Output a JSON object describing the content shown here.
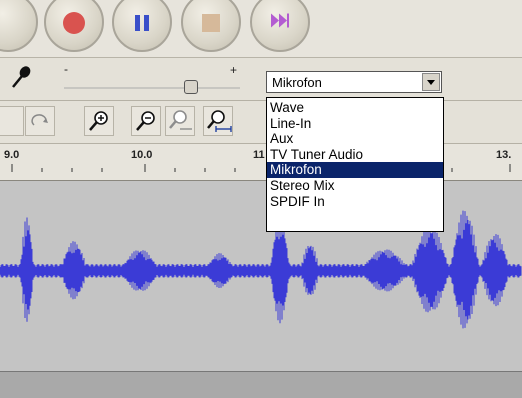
{
  "transport": {
    "buttons": [
      {
        "name": "rewind-button",
        "icon": "skip-back-icon"
      },
      {
        "name": "record-button",
        "icon": "record-icon",
        "color": "#d9534f"
      },
      {
        "name": "pause-button",
        "icon": "pause-icon",
        "color": "#3a4fc9"
      },
      {
        "name": "stop-button",
        "icon": "stop-icon",
        "color": "#d6b99a"
      },
      {
        "name": "fast-forward-button",
        "icon": "skip-forward-icon",
        "color": "#b35cd1"
      }
    ]
  },
  "mixer": {
    "mic_icon": "microphone-icon",
    "slider_minus": "-",
    "slider_plus": "+",
    "input_source": {
      "selected": "Mikrofon",
      "options": [
        "Wave",
        "Line-In",
        "Aux",
        "TV Tuner Audio",
        "Mikrofon",
        "Stereo Mix",
        "SPDIF In"
      ]
    }
  },
  "ruler": {
    "labels": [
      "9.0",
      "10.0",
      "11",
      "13."
    ]
  },
  "colors": {
    "waveform": "#3b3bd6",
    "track_bg": "#c4c4c4",
    "selection": "#0a246a"
  }
}
